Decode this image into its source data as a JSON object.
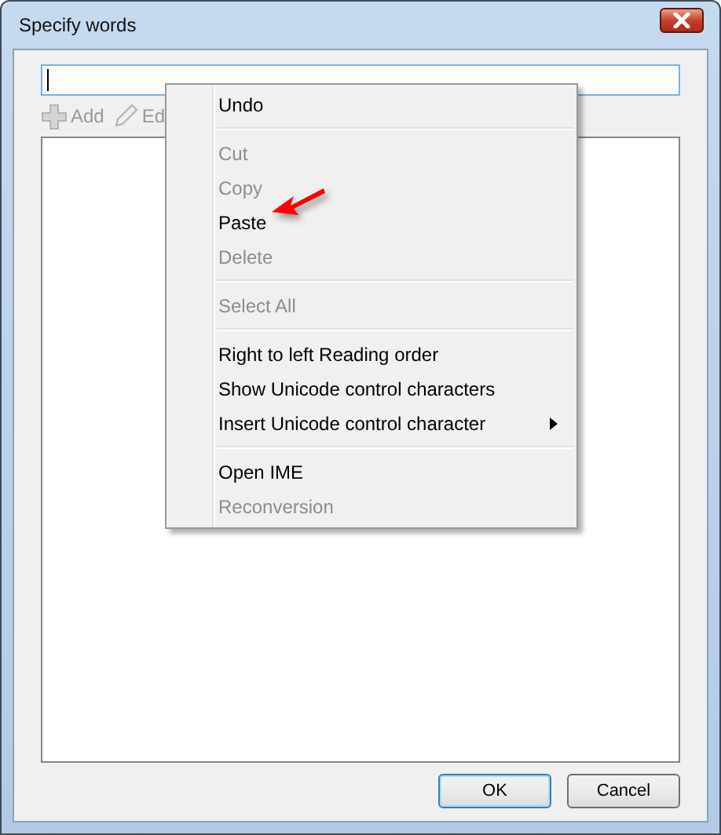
{
  "window": {
    "title": "Specify words"
  },
  "toolbar": [
    {
      "label": "Add",
      "kind": "add",
      "disabled": true
    },
    {
      "label": "Ed",
      "kind": "edit",
      "disabled": true
    }
  ],
  "buttons": [
    {
      "label": "OK",
      "default": true
    },
    {
      "label": "Cancel",
      "default": false
    }
  ],
  "context_menu": {
    "groups": [
      [
        {
          "label": "Undo",
          "disabled": false,
          "submenu": false
        }
      ],
      [
        {
          "label": "Cut",
          "disabled": true,
          "submenu": false
        },
        {
          "label": "Copy",
          "disabled": true,
          "submenu": false
        },
        {
          "label": "Paste",
          "disabled": false,
          "submenu": false
        },
        {
          "label": "Delete",
          "disabled": true,
          "submenu": false
        }
      ],
      [
        {
          "label": "Select All",
          "disabled": true,
          "submenu": false
        }
      ],
      [
        {
          "label": "Right to left Reading order",
          "disabled": false,
          "submenu": false
        },
        {
          "label": "Show Unicode control characters",
          "disabled": false,
          "submenu": false
        },
        {
          "label": "Insert Unicode control character",
          "disabled": false,
          "submenu": true
        }
      ],
      [
        {
          "label": "Open IME",
          "disabled": false,
          "submenu": false
        },
        {
          "label": "Reconversion",
          "disabled": true,
          "submenu": false
        }
      ]
    ]
  }
}
